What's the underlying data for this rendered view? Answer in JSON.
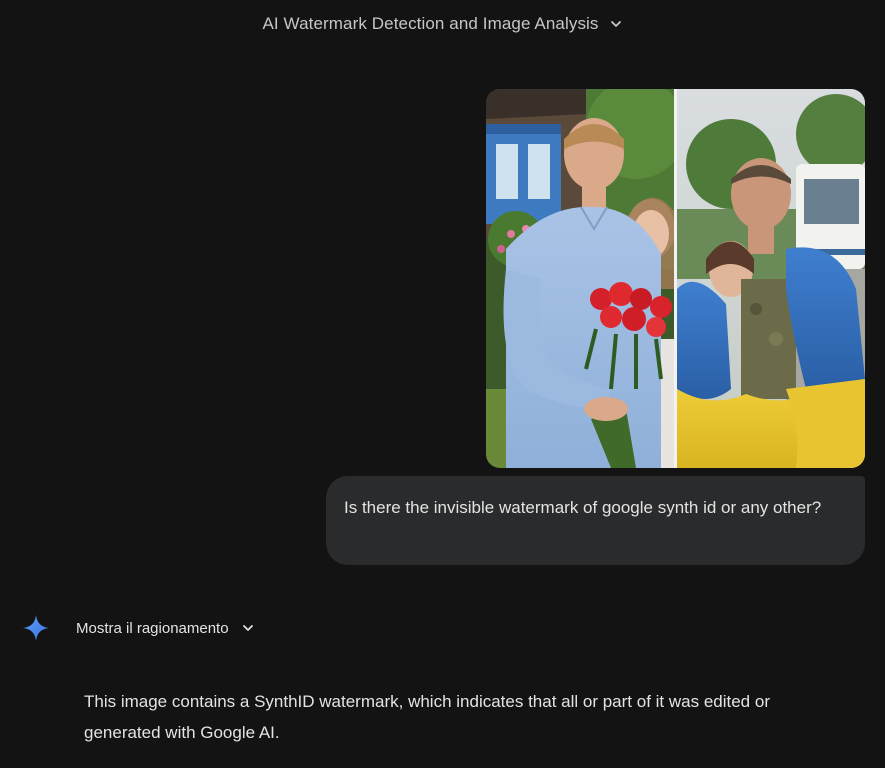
{
  "header": {
    "title": "AI Watermark Detection and Image Analysis",
    "chevron_icon": "chevron-down-icon"
  },
  "conversation": {
    "user_message": {
      "attachment": {
        "type": "image",
        "description_icon": "uploaded-photo"
      },
      "text": "Is there the invisible watermark of google synth id or any other?"
    },
    "model_response": {
      "avatar_icon": "gemini-spark-icon",
      "reasoning_toggle_label": "Mostra il ragionamento",
      "text": "This image contains a SynthID watermark, which indicates that all or part of it was edited or generated with Google AI."
    }
  },
  "colors": {
    "background": "#131314",
    "bubble": "#2a2b2c",
    "text": "#e3e3e3",
    "header_text": "#c4c7c5",
    "spark_blue": "#4a8af4"
  }
}
